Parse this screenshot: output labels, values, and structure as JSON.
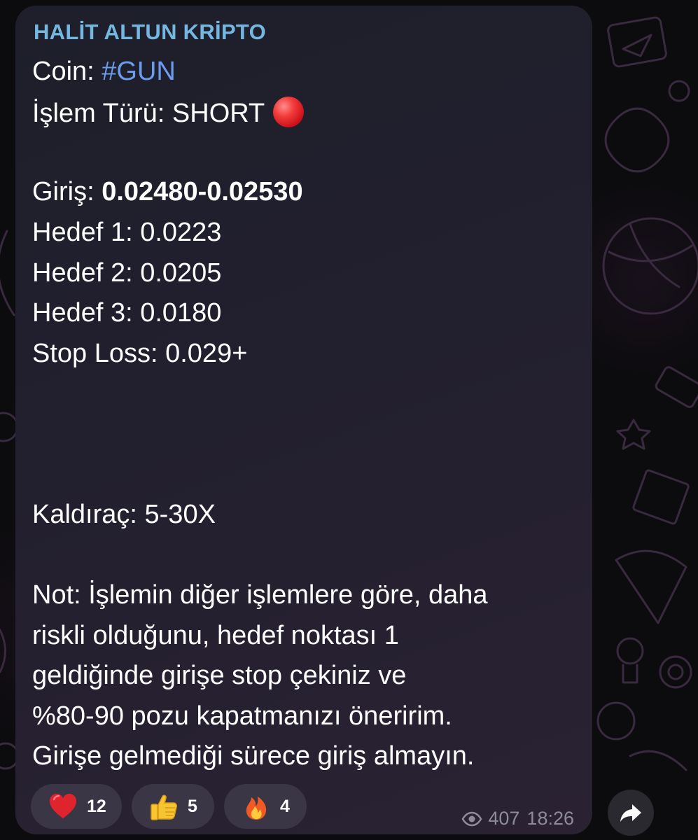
{
  "message": {
    "channel_name": "HALİT ALTUN KRİPTO",
    "coin_label": "Coin: ",
    "coin_value": "#GUN",
    "type_label": "İşlem Türü: SHORT",
    "entry_label": "Giriş: ",
    "entry_value": "0.02480-0.02530",
    "target1": "Hedef 1: 0.0223",
    "target2": "Hedef 2: 0.0205",
    "target3": "Hedef 3: 0.0180",
    "stop_loss": "Stop Loss: 0.029+",
    "leverage": "Kaldıraç: 5-30X",
    "note_lines": [
      "Not: İşlemin diğer işlemlere göre, daha",
      "riskli olduğunu, hedef noktası 1",
      "geldiğinde girişe stop çekiniz ve",
      "%80-90 pozu kapatmanızı öneririm.",
      "Girişe gelmediği sürece giriş almayın."
    ]
  },
  "reactions": [
    {
      "emoji": "heart-icon",
      "count": "12"
    },
    {
      "emoji": "thumbs-up-icon",
      "count": "5"
    },
    {
      "emoji": "fire-icon",
      "count": "4"
    }
  ],
  "meta": {
    "views": "407",
    "time": "18:26"
  },
  "colors": {
    "channel_name": "#74b7e0",
    "hashtag": "#6a9cf0",
    "bubble": "#221f2e",
    "reaction_bg": "#3a3645",
    "meta_text": "#8e8c99"
  }
}
